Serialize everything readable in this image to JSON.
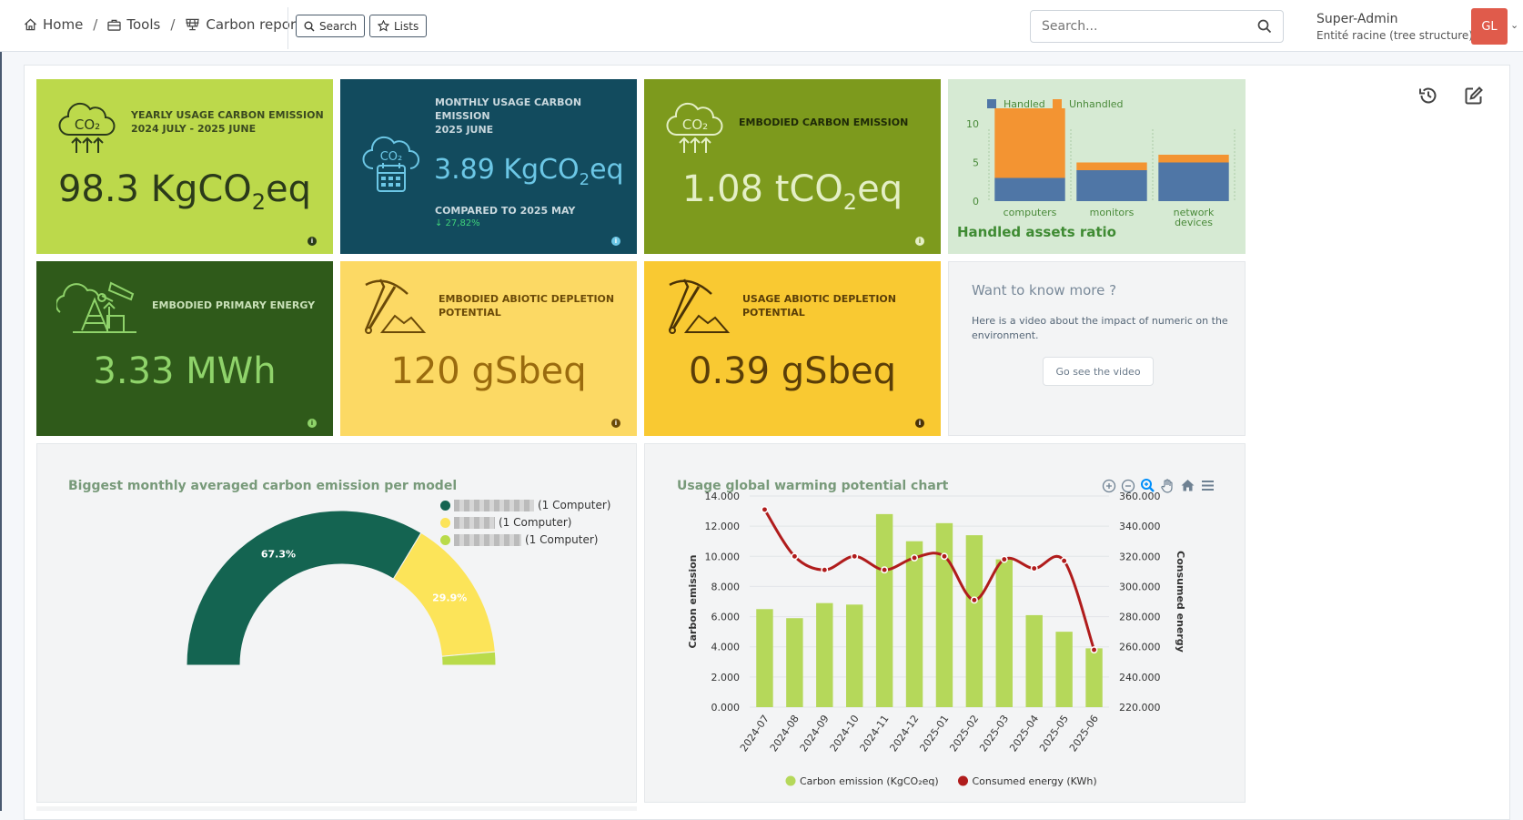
{
  "breadcrumbs": [
    {
      "label": "Home",
      "icon": "home-icon"
    },
    {
      "label": "Tools",
      "icon": "briefcase-icon"
    },
    {
      "label": "Carbon report",
      "icon": "solar-panel-icon"
    }
  ],
  "toolbar": {
    "search_label": "Search",
    "lists_label": "Lists"
  },
  "global_search": {
    "placeholder": "Search..."
  },
  "user": {
    "name": "Super-Admin",
    "entity": "Entité racine (tree structure)",
    "initials": "GL"
  },
  "colors": {
    "lime": "#bcd94b",
    "navy": "#124b5e",
    "olive": "#7d9a1d",
    "darkgreen": "#2f5a1a",
    "yellow": "#fcd964",
    "gold": "#f9c932",
    "pale": "#d6ead3",
    "grey": "#f3f4f5"
  },
  "cards": {
    "yearly": {
      "title1": "YEARLY USAGE CARBON EMISSION",
      "title2": "2024 JULY - 2025 JUNE",
      "value": "98.3",
      "unit": "KgCO",
      "unit_sub": "2",
      "unit_tail": "eq"
    },
    "monthly": {
      "title1": "MONTHLY USAGE CARBON",
      "title2": "EMISSION",
      "title3": "2025 JUNE",
      "value": "3.89",
      "unit": "KgCO",
      "unit_sub": "2",
      "unit_tail": "eq",
      "compare": "COMPARED TO 2025 MAY",
      "delta": "↓ 27,82%"
    },
    "embodied": {
      "title": "EMBODIED CARBON EMISSION",
      "value": "1.08",
      "unit": "tCO",
      "unit_sub": "2",
      "unit_tail": "eq"
    },
    "primary": {
      "title": "EMBODIED PRIMARY ENERGY",
      "value": "3.33 MWh"
    },
    "abiotic": {
      "title1": "EMBODIED ABIOTIC DEPLETION",
      "title2": "POTENTIAL",
      "value": "120 gSbeq"
    },
    "usage_abiotic": {
      "title1": "USAGE ABIOTIC DEPLETION",
      "title2": "POTENTIAL",
      "value": "0.39 gSbeq"
    },
    "more": {
      "title": "Want to know more ?",
      "text1": "Here is a video about the impact of numeric on the",
      "text2": "environment.",
      "button": "Go see the video"
    }
  },
  "chart_data": [
    {
      "type": "bar",
      "title": "Handled assets ratio",
      "categories": [
        "computers",
        "monitors",
        "network devices"
      ],
      "series": [
        {
          "name": "Handled",
          "color": "#4f76a6",
          "values": [
            3,
            4,
            5
          ]
        },
        {
          "name": "Unhandled",
          "color": "#f39432",
          "values": [
            9,
            1,
            1
          ]
        }
      ],
      "ylim": [
        0,
        12
      ],
      "yticks": [
        0,
        5,
        10
      ],
      "legend": "top-left"
    },
    {
      "type": "pie",
      "title": "Biggest monthly averaged carbon emission per model",
      "slices": [
        {
          "label": "(1 Computer)",
          "value": 67.3,
          "display": "67.3%",
          "color": "#146451"
        },
        {
          "label": "(1 Computer)",
          "value": 29.9,
          "display": "29.9%",
          "color": "#fce459"
        },
        {
          "label": "(1 Computer)",
          "value": 2.8,
          "display": "",
          "color": "#b9db4a"
        }
      ],
      "legend": "right"
    },
    {
      "type": "bar",
      "title": "Usage global warming potential chart",
      "categories": [
        "2024-07",
        "2024-08",
        "2024-09",
        "2024-10",
        "2024-11",
        "2024-12",
        "2025-01",
        "2025-02",
        "2025-03",
        "2025-04",
        "2025-05",
        "2025-06"
      ],
      "series": [
        {
          "name": "Carbon emission (KgCO₂eq)",
          "type": "bar",
          "color": "#b5d85a",
          "axis": "left",
          "values": [
            6.5,
            5.9,
            6.9,
            6.8,
            12.8,
            11.0,
            12.2,
            11.4,
            9.8,
            6.1,
            5.0,
            3.9
          ]
        },
        {
          "name": "Consumed energy (KWh)",
          "type": "line",
          "color": "#b01c1c",
          "axis": "right",
          "values": [
            351000,
            320000,
            311000,
            320000,
            311000,
            319000,
            320000,
            291000,
            318000,
            312000,
            317000,
            258000
          ]
        }
      ],
      "ylabel": "Carbon emission",
      "y2label": "Consumed energy",
      "ylim": [
        0,
        14
      ],
      "y2lim": [
        220000,
        360000
      ],
      "yticks": [
        "0.000",
        "2.000",
        "4.000",
        "6.000",
        "8.000",
        "10.000",
        "12.000",
        "14.000"
      ],
      "y2ticks": [
        "220.000",
        "240.000",
        "260.000",
        "280.000",
        "300.000",
        "320.000",
        "340.000",
        "360.000"
      ],
      "legend": "bottom"
    }
  ]
}
